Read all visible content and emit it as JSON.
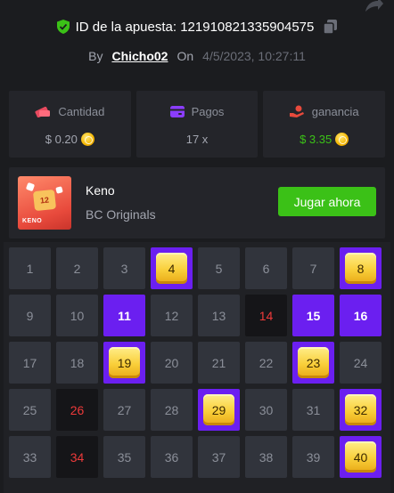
{
  "header": {
    "bet_id_label": "ID de la apuesta: 121910821335904575",
    "by_label": "By",
    "username": "Chicho02",
    "on_label": "On",
    "datetime": "4/5/2023, 10:27:11"
  },
  "stats": {
    "amount_label": "Cantidad",
    "amount_value": "$ 0.20",
    "payout_label": "Pagos",
    "payout_value": "17 x",
    "profit_label": "ganancia",
    "profit_value": "$ 3.35"
  },
  "game": {
    "name": "Keno",
    "provider": "BC Originals",
    "play_button": "Jugar ahora",
    "thumb_number": "12",
    "thumb_title": "KENO"
  },
  "colors": {
    "background": "#1b1c1f",
    "card": "#24252a",
    "accent_green": "#3bc117",
    "selected_purple": "#6b1ff0",
    "drawn_red": "#ed3a3a"
  },
  "board": {
    "cells": [
      {
        "n": "1",
        "state": "normal"
      },
      {
        "n": "2",
        "state": "normal"
      },
      {
        "n": "3",
        "state": "normal"
      },
      {
        "n": "4",
        "state": "hit"
      },
      {
        "n": "5",
        "state": "normal"
      },
      {
        "n": "6",
        "state": "normal"
      },
      {
        "n": "7",
        "state": "normal"
      },
      {
        "n": "8",
        "state": "hit"
      },
      {
        "n": "9",
        "state": "normal"
      },
      {
        "n": "10",
        "state": "normal"
      },
      {
        "n": "11",
        "state": "selected"
      },
      {
        "n": "12",
        "state": "normal"
      },
      {
        "n": "13",
        "state": "normal"
      },
      {
        "n": "14",
        "state": "drawn"
      },
      {
        "n": "15",
        "state": "selected"
      },
      {
        "n": "16",
        "state": "selected"
      },
      {
        "n": "17",
        "state": "normal"
      },
      {
        "n": "18",
        "state": "normal"
      },
      {
        "n": "19",
        "state": "hit"
      },
      {
        "n": "20",
        "state": "normal"
      },
      {
        "n": "21",
        "state": "normal"
      },
      {
        "n": "22",
        "state": "normal"
      },
      {
        "n": "23",
        "state": "hit"
      },
      {
        "n": "24",
        "state": "normal"
      },
      {
        "n": "25",
        "state": "normal"
      },
      {
        "n": "26",
        "state": "drawn"
      },
      {
        "n": "27",
        "state": "normal"
      },
      {
        "n": "28",
        "state": "normal"
      },
      {
        "n": "29",
        "state": "hit"
      },
      {
        "n": "30",
        "state": "normal"
      },
      {
        "n": "31",
        "state": "normal"
      },
      {
        "n": "32",
        "state": "hit"
      },
      {
        "n": "33",
        "state": "normal"
      },
      {
        "n": "34",
        "state": "drawn"
      },
      {
        "n": "35",
        "state": "normal"
      },
      {
        "n": "36",
        "state": "normal"
      },
      {
        "n": "37",
        "state": "normal"
      },
      {
        "n": "38",
        "state": "normal"
      },
      {
        "n": "39",
        "state": "normal"
      },
      {
        "n": "40",
        "state": "hit"
      }
    ]
  }
}
